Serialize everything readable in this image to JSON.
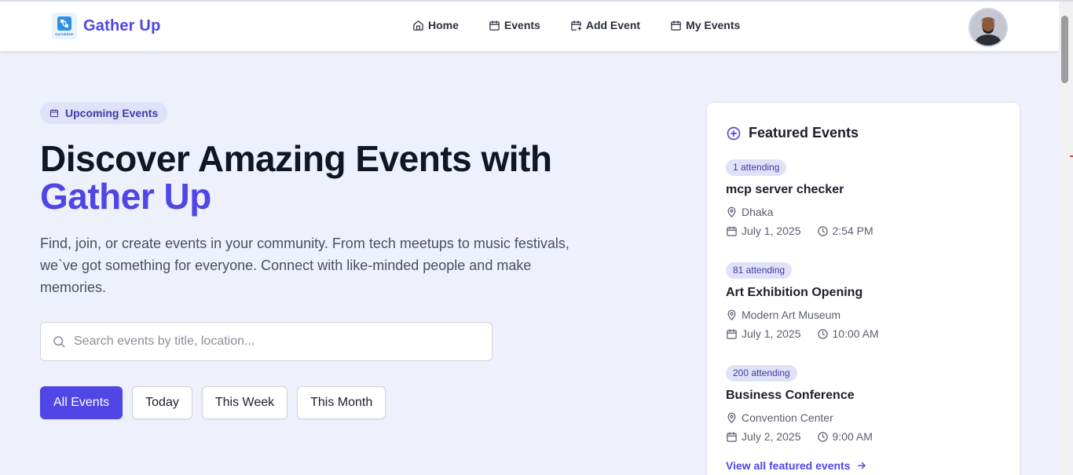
{
  "brand": {
    "name": "Gather Up",
    "logo_text": "GATHERUP"
  },
  "nav": {
    "items": [
      {
        "label": "Home",
        "icon": "home-icon"
      },
      {
        "label": "Events",
        "icon": "calendar-icon"
      },
      {
        "label": "Add Event",
        "icon": "calendar-plus-icon"
      },
      {
        "label": "My Events",
        "icon": "calendar-icon"
      }
    ]
  },
  "hero": {
    "badge": "Upcoming Events",
    "title_line1": "Discover Amazing Events with",
    "title_accent": "Gather Up",
    "description": "Find, join, or create events in your community. From tech meetups to music festivals, we`ve got something for everyone. Connect with like-minded people and make memories.",
    "search_placeholder": "Search events by title, location..."
  },
  "filters": [
    {
      "label": "All Events",
      "active": true
    },
    {
      "label": "Today",
      "active": false
    },
    {
      "label": "This Week",
      "active": false
    },
    {
      "label": "This Month",
      "active": false
    }
  ],
  "featured": {
    "heading": "Featured Events",
    "events": [
      {
        "attending": "1 attending",
        "title": "mcp server checker",
        "location": "Dhaka",
        "date": "July 1, 2025",
        "time": "2:54 PM"
      },
      {
        "attending": "81 attending",
        "title": "Art Exhibition Opening",
        "location": "Modern Art Museum",
        "date": "July 1, 2025",
        "time": "10:00 AM"
      },
      {
        "attending": "200 attending",
        "title": "Business Conference",
        "location": "Convention Center",
        "date": "July 2, 2025",
        "time": "9:00 AM"
      }
    ],
    "view_all": "View all featured events"
  },
  "colors": {
    "accent": "#4f46e5",
    "background": "#eef0fb",
    "badge_bg": "#e0e2f7"
  }
}
